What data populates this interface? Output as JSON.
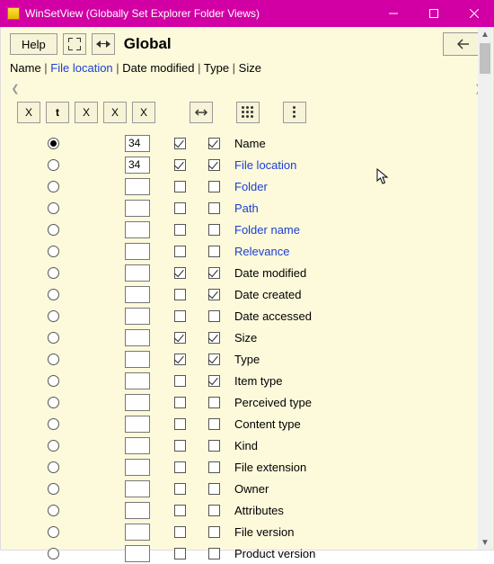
{
  "titlebar": {
    "title": "WinSetView (Globally Set Explorer Folder Views)"
  },
  "toolbar": {
    "help": "Help",
    "global_label": "Global",
    "x_buttons": [
      "X",
      "t",
      "X",
      "X",
      "X"
    ]
  },
  "breadcrumb": {
    "parts": [
      {
        "text": "Name",
        "link": false
      },
      {
        "text": "File location",
        "link": true
      },
      {
        "text": "Date modified",
        "link": false
      },
      {
        "text": "Type",
        "link": false
      },
      {
        "text": "Size",
        "link": false
      }
    ]
  },
  "rows": [
    {
      "radio": true,
      "input": "34",
      "c1": true,
      "c2": true,
      "label": "Name",
      "link": false
    },
    {
      "radio": false,
      "input": "34",
      "c1": true,
      "c2": true,
      "label": "File location",
      "link": true
    },
    {
      "radio": false,
      "input": "",
      "c1": false,
      "c2": false,
      "label": "Folder",
      "link": true
    },
    {
      "radio": false,
      "input": "",
      "c1": false,
      "c2": false,
      "label": "Path",
      "link": true
    },
    {
      "radio": false,
      "input": "",
      "c1": false,
      "c2": false,
      "label": "Folder name",
      "link": true
    },
    {
      "radio": false,
      "input": "",
      "c1": false,
      "c2": false,
      "label": "Relevance",
      "link": true
    },
    {
      "radio": false,
      "input": "",
      "c1": true,
      "c2": true,
      "label": "Date modified",
      "link": false
    },
    {
      "radio": false,
      "input": "",
      "c1": false,
      "c2": true,
      "label": "Date created",
      "link": false
    },
    {
      "radio": false,
      "input": "",
      "c1": false,
      "c2": false,
      "label": "Date accessed",
      "link": false
    },
    {
      "radio": false,
      "input": "",
      "c1": true,
      "c2": true,
      "label": "Size",
      "link": false
    },
    {
      "radio": false,
      "input": "",
      "c1": true,
      "c2": true,
      "label": "Type",
      "link": false
    },
    {
      "radio": false,
      "input": "",
      "c1": false,
      "c2": true,
      "label": "Item type",
      "link": false
    },
    {
      "radio": false,
      "input": "",
      "c1": false,
      "c2": false,
      "label": "Perceived type",
      "link": false
    },
    {
      "radio": false,
      "input": "",
      "c1": false,
      "c2": false,
      "label": "Content type",
      "link": false
    },
    {
      "radio": false,
      "input": "",
      "c1": false,
      "c2": false,
      "label": "Kind",
      "link": false
    },
    {
      "radio": false,
      "input": "",
      "c1": false,
      "c2": false,
      "label": "File extension",
      "link": false
    },
    {
      "radio": false,
      "input": "",
      "c1": false,
      "c2": false,
      "label": "Owner",
      "link": false
    },
    {
      "radio": false,
      "input": "",
      "c1": false,
      "c2": false,
      "label": "Attributes",
      "link": false
    },
    {
      "radio": false,
      "input": "",
      "c1": false,
      "c2": false,
      "label": "File version",
      "link": false
    },
    {
      "radio": false,
      "input": "",
      "c1": false,
      "c2": false,
      "label": "Product version",
      "link": false
    }
  ]
}
